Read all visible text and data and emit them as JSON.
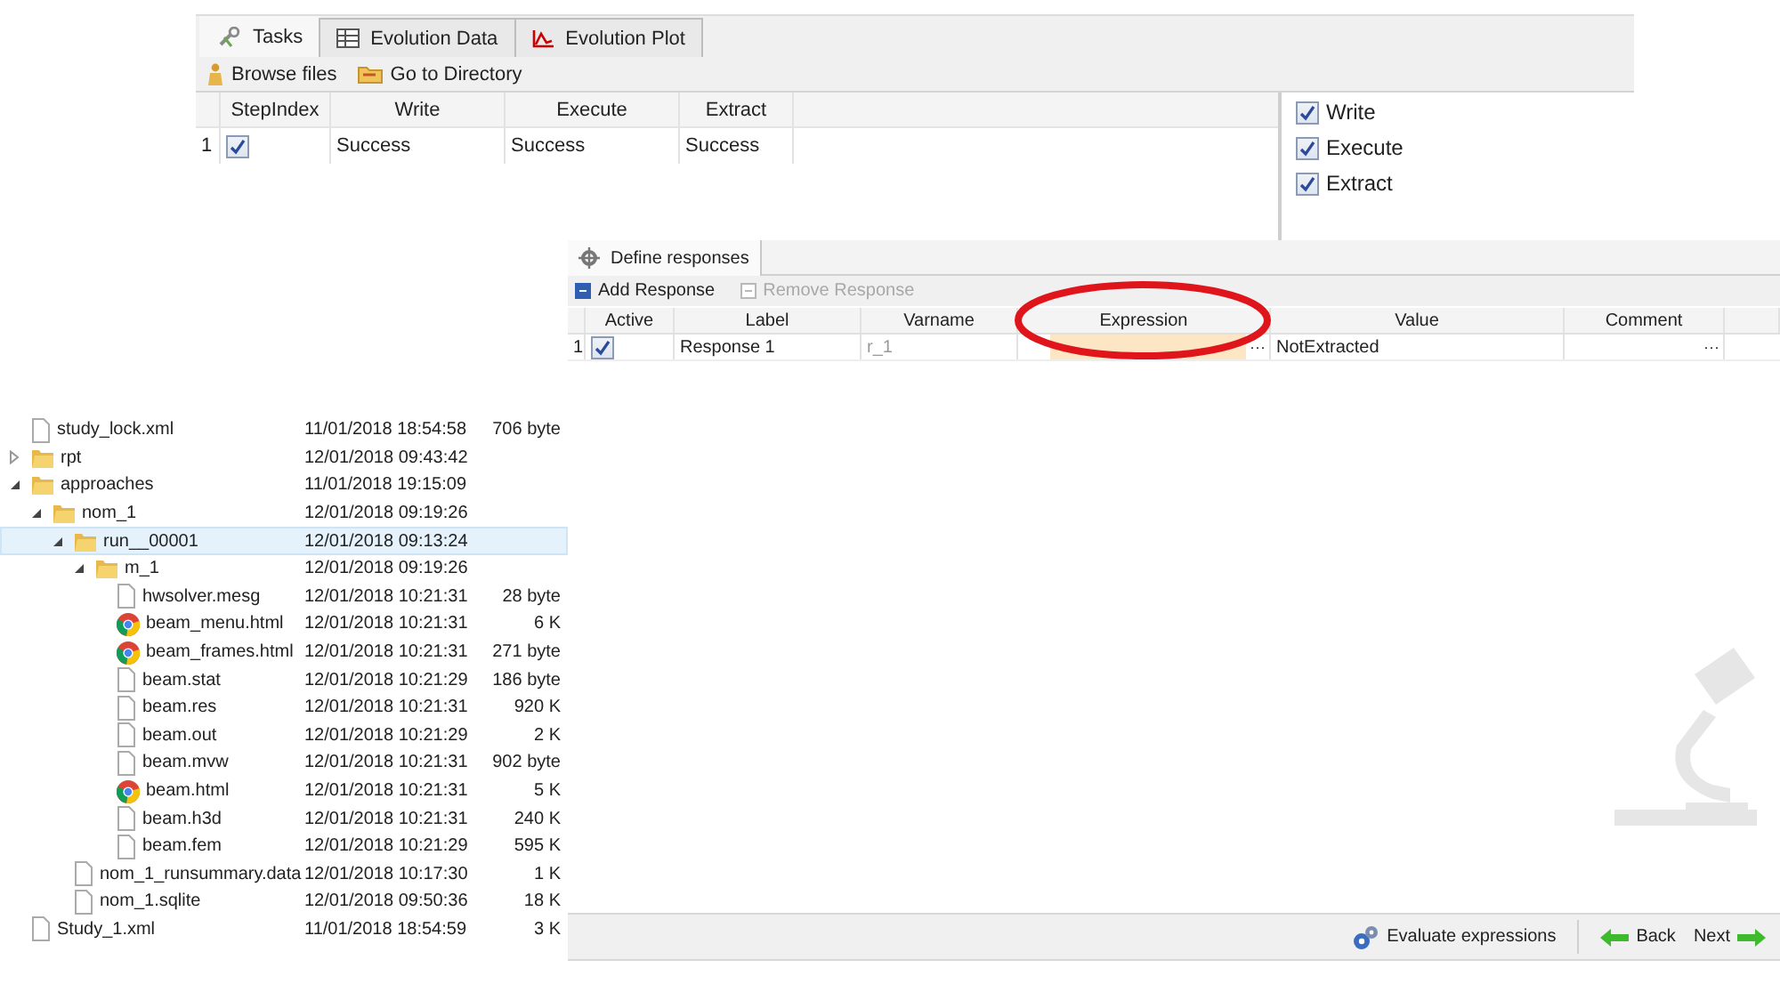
{
  "tasks_panel": {
    "tabs": [
      {
        "label": "Tasks",
        "selected": true
      },
      {
        "label": "Evolution Data",
        "selected": false
      },
      {
        "label": "Evolution Plot",
        "selected": false
      }
    ],
    "toolbar": [
      "Browse files",
      "Go to Directory"
    ],
    "table": {
      "columns": [
        "StepIndex",
        "Write",
        "Execute",
        "Extract"
      ],
      "rows": [
        {
          "index": "1",
          "cells": [
            {
              "kind": "checkbox",
              "checked": true
            },
            {
              "kind": "text",
              "text": "Success"
            },
            {
              "kind": "text",
              "text": "Success"
            },
            {
              "kind": "text",
              "text": "Success"
            }
          ]
        }
      ]
    },
    "options": [
      {
        "label": "Write",
        "checked": true
      },
      {
        "label": "Execute",
        "checked": true
      },
      {
        "label": "Extract",
        "checked": true
      }
    ]
  },
  "responses_panel": {
    "tab": {
      "label": "Define responses",
      "selected": true
    },
    "toolbar": [
      {
        "label": "Add Response",
        "disabled": false
      },
      {
        "label": "Remove Response",
        "disabled": true
      }
    ],
    "table": {
      "columns": [
        "Active",
        "Label",
        "Varname",
        "Expression",
        "Value",
        "Comment"
      ],
      "rows": [
        {
          "index": "1",
          "active": true,
          "label": "Response 1",
          "varname": "r_1",
          "expression_button": "···",
          "value": "NotExtracted",
          "comment_button": "···"
        }
      ]
    },
    "annotation": {
      "kind": "ellipse"
    },
    "footer": {
      "evaluate": "Evaluate expressions",
      "back": "Back",
      "next": "Next"
    }
  },
  "file_tree": {
    "items": [
      {
        "kind": "file",
        "name": "study_lock.xml",
        "modified": "11/01/2018 18:54:58",
        "size": "706 byte",
        "selected": false
      },
      {
        "kind": "folder",
        "name": "rpt",
        "modified": "12/01/2018 09:43:42",
        "expanded": false,
        "selected": false
      },
      {
        "kind": "folder",
        "name": "approaches",
        "modified": "11/01/2018 19:15:09",
        "expanded": true,
        "selected": false,
        "children": [
          {
            "kind": "folder",
            "name": "nom_1",
            "modified": "12/01/2018 09:19:26",
            "expanded": true,
            "selected": false,
            "children": [
              {
                "kind": "folder",
                "name": "run__00001",
                "modified": "12/01/2018 09:13:24",
                "expanded": true,
                "selected": true,
                "children": [
                  {
                    "kind": "folder",
                    "name": "m_1",
                    "modified": "12/01/2018 09:19:26",
                    "expanded": true,
                    "selected": false,
                    "children": [
                      {
                        "kind": "file",
                        "name": "hwsolver.mesg",
                        "modified": "12/01/2018 10:21:31",
                        "size": "28 byte",
                        "selected": false
                      },
                      {
                        "kind": "web",
                        "name": "beam_menu.html",
                        "modified": "12/01/2018 10:21:31",
                        "size": "6 K",
                        "selected": false
                      },
                      {
                        "kind": "web",
                        "name": "beam_frames.html",
                        "modified": "12/01/2018 10:21:31",
                        "size": "271 byte",
                        "selected": false
                      },
                      {
                        "kind": "file",
                        "name": "beam.stat",
                        "modified": "12/01/2018 10:21:29",
                        "size": "186 byte",
                        "selected": false
                      },
                      {
                        "kind": "file",
                        "name": "beam.res",
                        "modified": "12/01/2018 10:21:31",
                        "size": "920 K",
                        "selected": false
                      },
                      {
                        "kind": "file",
                        "name": "beam.out",
                        "modified": "12/01/2018 10:21:29",
                        "size": "2 K",
                        "selected": false
                      },
                      {
                        "kind": "file",
                        "name": "beam.mvw",
                        "modified": "12/01/2018 10:21:31",
                        "size": "902 byte",
                        "selected": false
                      },
                      {
                        "kind": "web",
                        "name": "beam.html",
                        "modified": "12/01/2018 10:21:31",
                        "size": "5 K",
                        "selected": false
                      },
                      {
                        "kind": "file",
                        "name": "beam.h3d",
                        "modified": "12/01/2018 10:21:31",
                        "size": "240 K",
                        "selected": false
                      },
                      {
                        "kind": "file",
                        "name": "beam.fem",
                        "modified": "12/01/2018 10:21:29",
                        "size": "595 K",
                        "selected": false
                      }
                    ]
                  }
                ]
              },
              {
                "kind": "file",
                "name": "nom_1_runsummary.data",
                "modified": "12/01/2018 10:17:30",
                "size": "1 K",
                "selected": false
              },
              {
                "kind": "file",
                "name": "nom_1.sqlite",
                "modified": "12/01/2018 09:50:36",
                "size": "18 K",
                "selected": false
              }
            ]
          }
        ]
      },
      {
        "kind": "file",
        "name": "Study_1.xml",
        "modified": "11/01/2018 18:54:59",
        "size": "3 K",
        "selected": false
      }
    ]
  }
}
